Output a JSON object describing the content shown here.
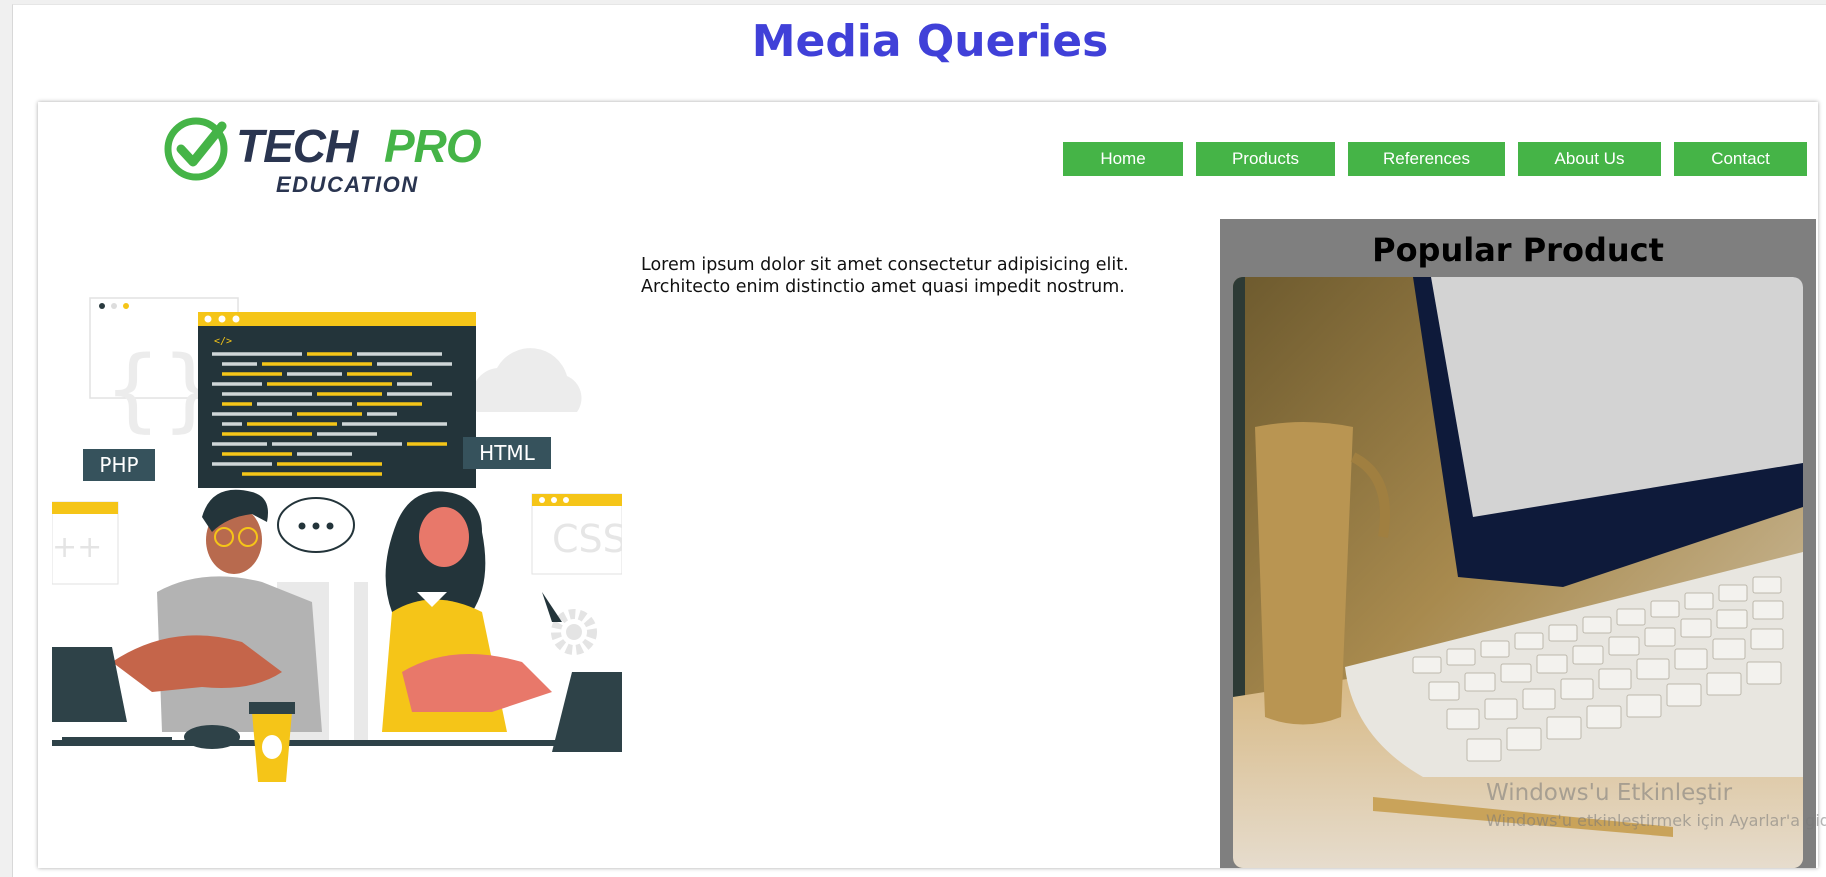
{
  "page": {
    "title": "Media Queries"
  },
  "logo": {
    "brand_tech": "TECH",
    "brand_pro": "PRO",
    "tagline": "EDUCATION"
  },
  "nav": {
    "items": [
      {
        "label": "Home"
      },
      {
        "label": "Products"
      },
      {
        "label": "References"
      },
      {
        "label": "About Us"
      },
      {
        "label": "Contact"
      }
    ]
  },
  "hero": {
    "badges": {
      "php": "PHP",
      "html": "HTML",
      "css": "CSS",
      "cpp": "++"
    }
  },
  "content": {
    "text": "Lorem ipsum dolor sit amet consectetur adipisicing elit. Architecto enim distinctio amet quasi impedit nostrum."
  },
  "aside": {
    "title": "Popular Product"
  },
  "os_watermark": {
    "title": "Windows'u Etkinleştir",
    "subtitle": "Windows'u etkinleştirmek için Ayarlar'a gidin."
  },
  "colors": {
    "accent": "#45b447",
    "title": "#4040d8",
    "navy": "#2a3550",
    "aside_bg": "#7f7f7f"
  }
}
